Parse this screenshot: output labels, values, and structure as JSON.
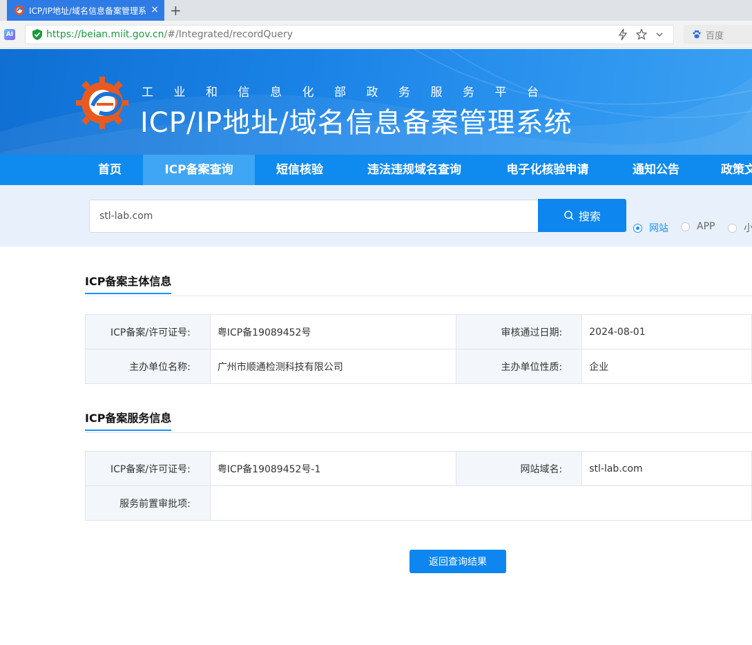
{
  "browser": {
    "tab_title": "ICP/IP地址/域名信息备案管理系",
    "tab_close": "×",
    "new_tab": "+",
    "ai_badge": "AI",
    "url_scheme": "https://",
    "url_host": "beian.miit.gov.cn",
    "url_path": "/#/Integrated/recordQuery",
    "search_engine": "百度"
  },
  "banner": {
    "ministry": "工业和信息化部政务服务平台",
    "title": "ICP/IP地址/域名信息备案管理系统"
  },
  "nav": {
    "items": [
      {
        "label": "首页"
      },
      {
        "label": "ICP备案查询"
      },
      {
        "label": "短信核验"
      },
      {
        "label": "违法违规域名查询"
      },
      {
        "label": "电子化核验申请"
      },
      {
        "label": "通知公告"
      },
      {
        "label": "政策文"
      }
    ],
    "active": "ICP备案查询"
  },
  "search": {
    "query": "stl-lab.com",
    "button_label": "搜索",
    "options": [
      {
        "label": "网站",
        "checked": true
      },
      {
        "label": "APP",
        "checked": false
      },
      {
        "label": "小",
        "checked": false
      }
    ]
  },
  "subject": {
    "title": "ICP备案主体信息",
    "rows": [
      {
        "label1": "ICP备案/许可证号:",
        "value1": "粤ICP备19089452号",
        "label2": "审核通过日期:",
        "value2": "2024-08-01"
      },
      {
        "label1": "主办单位名称:",
        "value1": "广州市顺通检测科技有限公司",
        "label2": "主办单位性质:",
        "value2": "企业"
      }
    ]
  },
  "service": {
    "title": "ICP备案服务信息",
    "license_label": "ICP备案/许可证号:",
    "license_value": "粤ICP备19089452号-1",
    "domain_label": "网站域名:",
    "domain_value": "stl-lab.com",
    "approval_label": "服务前置审批项:",
    "approval_value": ""
  },
  "back_button": "返回查询结果",
  "colors": {
    "primary": "#0d86f0",
    "nav_bg": "#0f8aef",
    "nav_active": "#3ea6f5",
    "search_bg": "#e8f1fb",
    "accent": "#1890ff"
  }
}
